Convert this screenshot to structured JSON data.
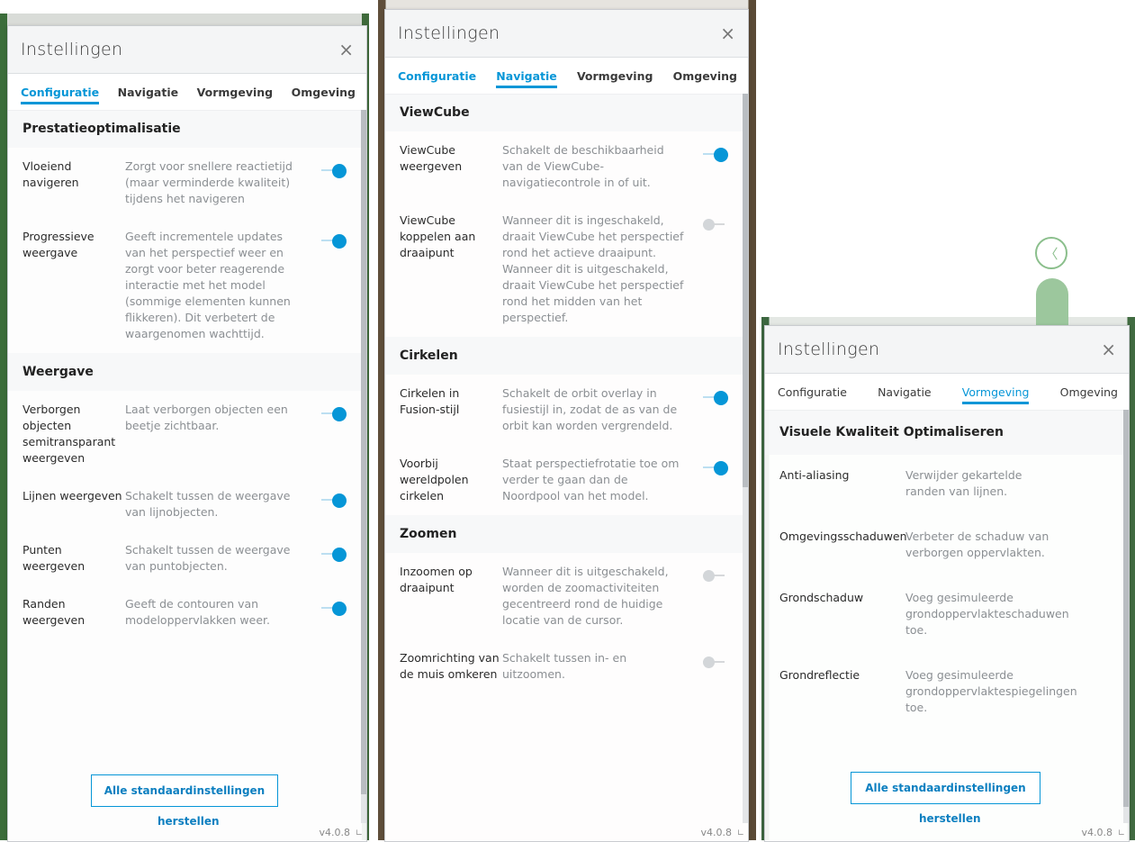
{
  "panel_title": "Instellingen",
  "close_symbol": "×",
  "tabs": [
    "Configuratie",
    "Navigatie",
    "Vormgeving",
    "Omgeving"
  ],
  "version": "v4.0.8",
  "reset_label_1": "Alle standaardinstellingen",
  "reset_label_2": "herstellen",
  "config": {
    "sections": [
      {
        "title": "Prestatieoptimalisatie"
      },
      {
        "title": "Weergave"
      }
    ],
    "rows": [
      {
        "label": "Vloeiend navigeren",
        "desc": "Zorgt voor snellere reactietijd (maar verminderde kwaliteit) tijdens het navigeren",
        "on": true
      },
      {
        "label": "Progressieve weergave",
        "desc": "Geeft incrementele updates van het perspectief weer en zorgt voor beter reagerende interactie met het model (sommige elementen kunnen flikkeren). Dit verbetert de waargenomen wachttijd.",
        "on": true
      },
      {
        "label": "Verborgen objecten semitransparant weergeven",
        "desc": "Laat verborgen objecten een beetje zichtbaar.",
        "on": true
      },
      {
        "label": "Lijnen weergeven",
        "desc": "Schakelt tussen de weergave van lijnobjecten.",
        "on": true
      },
      {
        "label": "Punten weergeven",
        "desc": "Schakelt tussen de weergave van puntobjecten.",
        "on": true
      },
      {
        "label": "Randen weergeven",
        "desc": "Geeft de contouren van modeloppervlakken weer.",
        "on": true
      }
    ]
  },
  "nav": {
    "sections": [
      {
        "title": "ViewCube"
      },
      {
        "title": "Cirkelen"
      },
      {
        "title": "Zoomen"
      }
    ],
    "rows": [
      {
        "label": "ViewCube weergeven",
        "desc": "Schakelt de beschikbaarheid van de ViewCube-navigatiecontrole in of uit.",
        "on": true
      },
      {
        "label": "ViewCube koppelen aan draaipunt",
        "desc": "Wanneer dit is ingeschakeld, draait ViewCube het perspectief rond het actieve draaipunt. Wanneer dit is uitgeschakeld, draait ViewCube het perspectief rond het midden van het perspectief.",
        "on": false
      },
      {
        "label": "Cirkelen in Fusion-stijl",
        "desc": "Schakelt de orbit overlay in fusiestijl in, zodat de as van de orbit kan worden vergrendeld.",
        "on": true
      },
      {
        "label": "Voorbij wereldpolen cirkelen",
        "desc": "Staat perspectiefrotatie toe om verder te gaan dan de Noordpool van het model.",
        "on": true
      },
      {
        "label": "Inzoomen op draaipunt",
        "desc": "Wanneer dit is uitgeschakeld, worden de zoomactiviteiten gecentreerd rond de huidige locatie van de cursor.",
        "on": false
      },
      {
        "label": "Zoomrichting van de muis omkeren",
        "desc": "Schakelt tussen in- en uitzoomen.",
        "on": false
      }
    ]
  },
  "look": {
    "sections": [
      {
        "title": "Visuele Kwaliteit Optimaliseren"
      }
    ],
    "rows": [
      {
        "label": "Anti-aliasing",
        "desc": "Verwijder gekartelde randen van lijnen."
      },
      {
        "label": "Omgevingsschaduwen",
        "desc": "Verbeter de schaduw van verborgen oppervlakten."
      },
      {
        "label": "Grondschaduw",
        "desc": "Voeg gesimuleerde grondoppervlakteschaduwen toe."
      },
      {
        "label": "Grondreflectie",
        "desc": "Voeg gesimuleerde grondoppervlaktespiegelingen toe."
      }
    ]
  }
}
